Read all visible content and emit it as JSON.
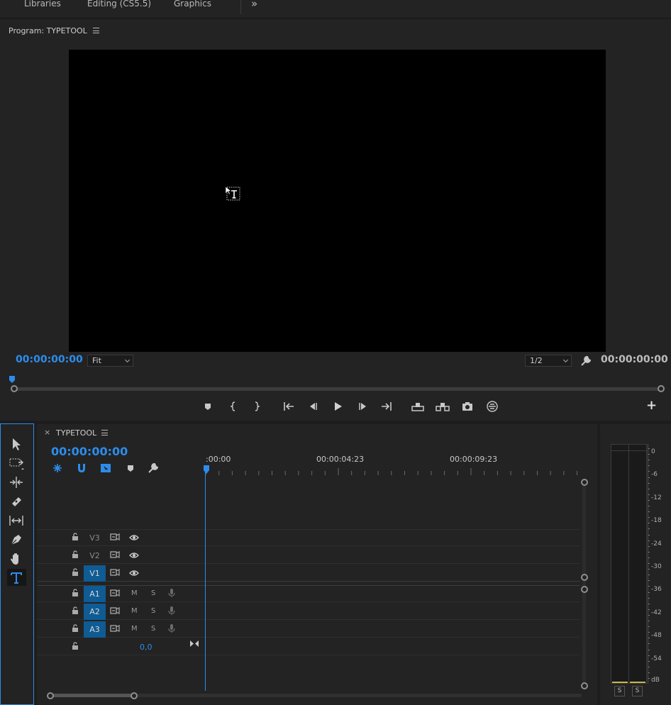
{
  "workspace_tabs": [
    "Libraries",
    "Editing (CS5.5)",
    "Graphics"
  ],
  "workspace_overflow": "»",
  "program_monitor": {
    "title": "Program: TYPETOOL",
    "timecode_left": "00:00:00:00",
    "zoom": "Fit",
    "resolution": "1/2",
    "timecode_right": "00:00:00:00",
    "controls": [
      "add-marker",
      "mark-in",
      "mark-out",
      "go-to-in",
      "step-back",
      "play",
      "step-forward",
      "go-to-out",
      "lift",
      "extract",
      "export-frame",
      "comparison-view"
    ],
    "add_button": "+"
  },
  "tools": [
    "selection-tool",
    "track-select-tool",
    "ripple-edit-tool",
    "razor-tool",
    "slip-tool",
    "pen-tool",
    "hand-tool",
    "type-tool"
  ],
  "active_tool": "type-tool",
  "timeline": {
    "close": "×",
    "sequence_name": "TYPETOOL",
    "timecode": "00:00:00:00",
    "ruler_labels": [
      ":00:00",
      "00:00:04:23",
      "00:00:09:23"
    ],
    "video_tracks": [
      {
        "label": "V3",
        "active": false
      },
      {
        "label": "V2",
        "active": false
      },
      {
        "label": "V1",
        "active": true
      }
    ],
    "audio_tracks": [
      {
        "label": "A1",
        "mute": "M",
        "solo": "S"
      },
      {
        "label": "A2",
        "mute": "M",
        "solo": "S"
      },
      {
        "label": "A3",
        "mute": "M",
        "solo": "S"
      }
    ],
    "master_value": "0,0"
  },
  "audio_meter": {
    "scale": [
      "0",
      "-6",
      "-12",
      "-18",
      "-24",
      "-30",
      "-36",
      "-42",
      "-48",
      "-54",
      "dB"
    ],
    "solo_buttons": [
      "S",
      "S"
    ]
  },
  "colors": {
    "accent": "#2d8ceb",
    "track_active": "#0f5b94",
    "panel": "#232323"
  }
}
